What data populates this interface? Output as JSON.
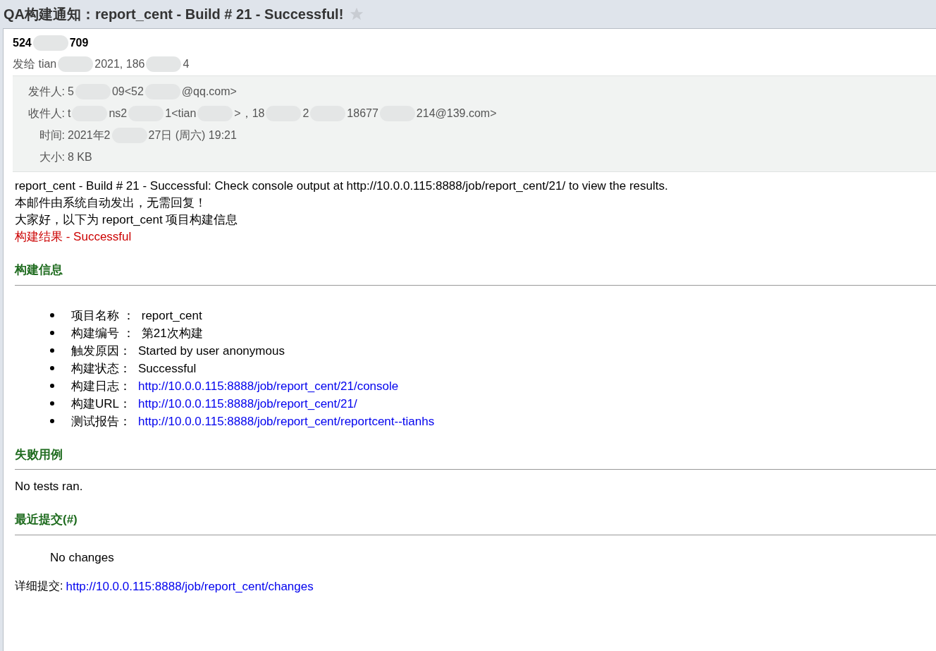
{
  "subject": {
    "title": "QA构建通知：report_cent - Build # 21 - Successful!",
    "starred": false
  },
  "sender_name": [
    "524",
    "709"
  ],
  "recipient_line": [
    "发给 tian",
    "2021, 186",
    "4"
  ],
  "details": [
    {
      "label": "发件人:",
      "parts": [
        "5",
        "09<52",
        "@qq.com>"
      ]
    },
    {
      "label": "收件人:",
      "parts": [
        "t",
        "ns2",
        "1<tian",
        ">，18",
        "2",
        "18677",
        "214@139.com>"
      ]
    },
    {
      "label": "时间:",
      "parts": [
        "2021年2",
        "27日 (周六) 19:21"
      ]
    },
    {
      "label": "大小:",
      "parts": [
        "8 KB"
      ]
    }
  ],
  "body": {
    "lines": [
      {
        "text": "report_cent - Build # 21 - Successful: Check console output at http://10.0.0.115:8888/job/report_cent/21/ to view the results.",
        "kind": "plain"
      },
      {
        "text": "本邮件由系统自动发出，无需回复！",
        "kind": "plain"
      },
      {
        "text": "大家好，以下为 report_cent 项目构建信息",
        "kind": "plain"
      },
      {
        "text": "构建结果 - Successful",
        "kind": "result"
      }
    ],
    "sections": [
      {
        "heading": "构建信息",
        "kind": "list",
        "items": [
          {
            "label": "项目名称 ：",
            "value": "report_cent",
            "kind": "text"
          },
          {
            "label": "构建编号 ：",
            "value": "第21次构建",
            "kind": "text"
          },
          {
            "label": "触发原因：",
            "value": "Started by user anonymous",
            "kind": "text"
          },
          {
            "label": "构建状态：",
            "value": "Successful",
            "kind": "text"
          },
          {
            "label": "构建日志：",
            "value": "http://10.0.0.115:8888/job/report_cent/21/console",
            "kind": "link"
          },
          {
            "label": "构建URL：",
            "value": "http://10.0.0.115:8888/job/report_cent/21/",
            "kind": "link"
          },
          {
            "label": "测试报告：",
            "value": "http://10.0.0.115:8888/job/report_cent/reportcent--tianhs",
            "kind": "link"
          }
        ]
      },
      {
        "heading": "失败用例",
        "kind": "text",
        "text": "No tests ran."
      },
      {
        "heading": "最近提交(#)",
        "kind": "indented",
        "text": "No changes"
      }
    ],
    "footer": {
      "label": "详细提交:",
      "link": "http://10.0.0.115:8888/job/report_cent/changes"
    }
  }
}
